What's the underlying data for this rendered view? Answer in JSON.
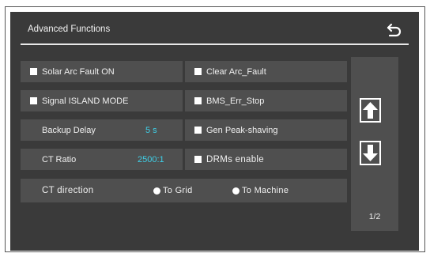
{
  "header": {
    "title": "Advanced Functions",
    "back_icon": "back-arrow-icon"
  },
  "options": {
    "solar_arc": "Solar Arc Fault ON",
    "clear_arc": "Clear Arc_Fault",
    "signal_island": "Signal ISLAND MODE",
    "bms_err": "BMS_Err_Stop",
    "backup_delay_label": "Backup Delay",
    "backup_delay_value": "5 s",
    "gen_peak": "Gen Peak-shaving",
    "ct_ratio_label": "CT Ratio",
    "ct_ratio_value": "2500:1",
    "drms": "DRMs enable",
    "ct_direction_label": "CT direction",
    "to_grid": "To Grid",
    "to_machine": "To Machine"
  },
  "nav": {
    "up_icon": "arrow-up-icon",
    "down_icon": "arrow-down-icon",
    "page": "1/2"
  },
  "colors": {
    "background": "#3a3a3a",
    "panel": "#4f4f4f",
    "value_accent": "#3fd0e8",
    "text": "#f0f0f0"
  }
}
